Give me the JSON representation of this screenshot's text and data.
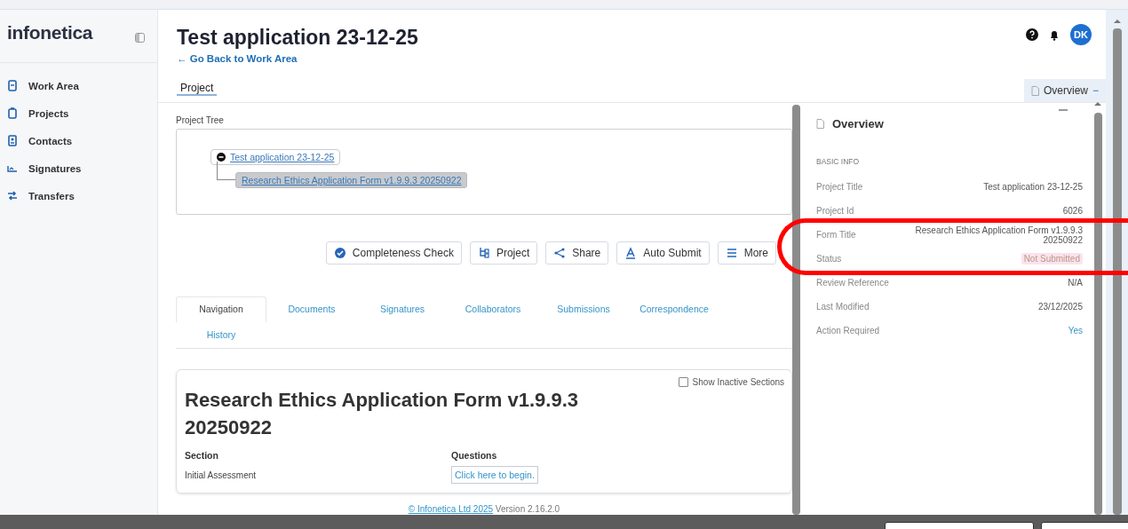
{
  "sidebar": {
    "logo": "infonetica",
    "items": [
      {
        "label": "Work Area"
      },
      {
        "label": "Projects"
      },
      {
        "label": "Contacts"
      },
      {
        "label": "Signatures"
      },
      {
        "label": "Transfers"
      }
    ]
  },
  "header": {
    "title": "Test application 23-12-25",
    "back_link": "← Go Back to Work Area",
    "avatar": "DK"
  },
  "page_tabs": [
    {
      "label": "Project",
      "selected": true
    }
  ],
  "overview_toggle": {
    "label": "Overview",
    "symbol": "−"
  },
  "project_tree": {
    "label": "Project Tree",
    "root": {
      "label": "Test application 23-12-25",
      "expanded": true,
      "children": [
        {
          "label": "Research Ethics Application Form v1.9.9.3 20250922",
          "selected": true
        }
      ]
    }
  },
  "actions": [
    "Completeness Check",
    "Project",
    "Share",
    "Auto Submit",
    "More"
  ],
  "tabs": [
    {
      "label": "Navigation",
      "selected": true
    },
    {
      "label": "Documents",
      "selected": false
    },
    {
      "label": "Signatures",
      "selected": false
    },
    {
      "label": "Collaborators",
      "selected": false
    },
    {
      "label": "Submissions",
      "selected": false
    },
    {
      "label": "Correspondence",
      "selected": false
    },
    {
      "label": "History",
      "selected": false
    }
  ],
  "form": {
    "title": "Research Ethics Application Form v1.9.9.3 20250922",
    "show_inactive": {
      "label": "Show Inactive Sections",
      "checked": false
    },
    "columns": [
      "Section",
      "Questions"
    ],
    "rows": [
      {
        "section": "Initial Assessment",
        "questions": "Click here to begin."
      }
    ]
  },
  "footer": {
    "copyright": "© Infonetica Ltd 2025",
    "version": "Version 2.16.2.0"
  },
  "overview": {
    "title": "Overview",
    "section": "BASIC INFO",
    "fields": [
      {
        "label": "Project Title",
        "value": "Test application 23-12-25",
        "kind": "text",
        "circled": false
      },
      {
        "label": "Project Id",
        "value": "6026",
        "kind": "text",
        "circled": false
      },
      {
        "label": "Form Title",
        "value": "Research Ethics Application Form v1.9.9.3 20250922",
        "kind": "text",
        "circled": true
      },
      {
        "label": "Status",
        "value": "Not Submitted",
        "kind": "badge",
        "circled": true
      },
      {
        "label": "Review Reference",
        "value": "N/A",
        "kind": "text",
        "circled": false
      },
      {
        "label": "Last Modified",
        "value": "23/12/2025",
        "kind": "text",
        "circled": false
      },
      {
        "label": "Action Required",
        "value": "Yes",
        "kind": "link",
        "circled": false
      }
    ]
  }
}
